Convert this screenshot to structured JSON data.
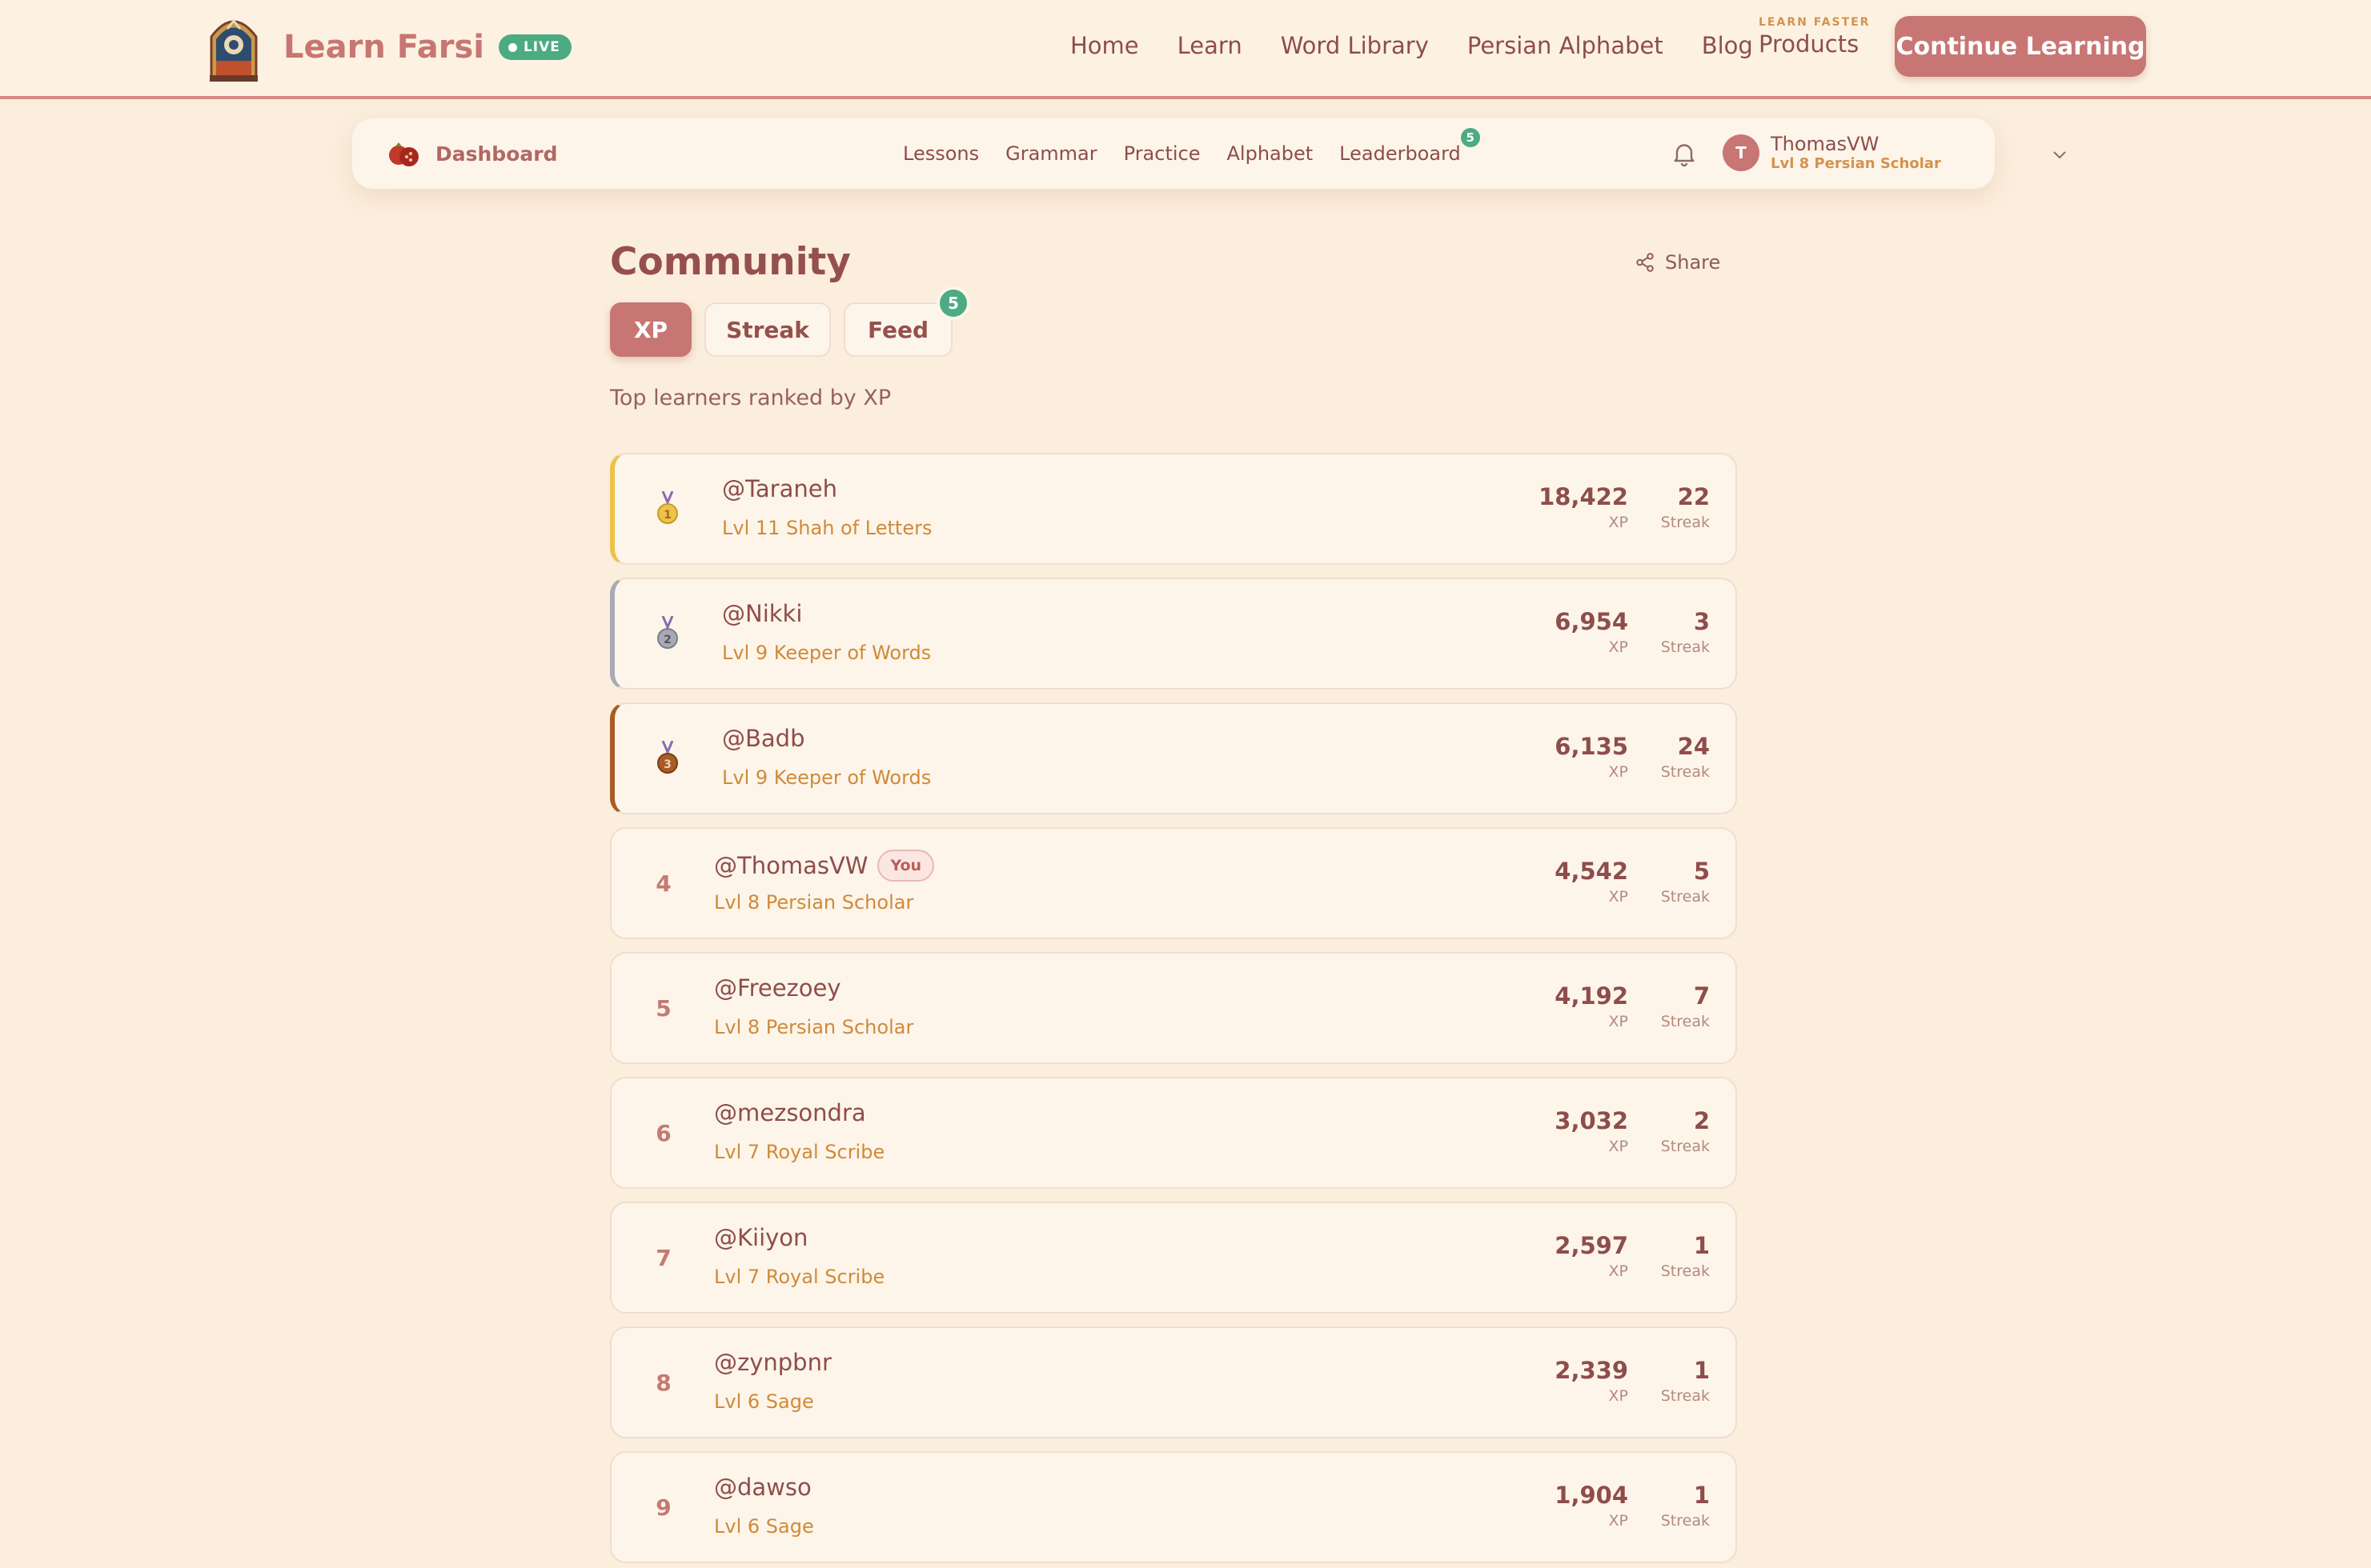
{
  "header": {
    "brand": "Learn Farsi",
    "live_badge": "LIVE",
    "nav": [
      "Home",
      "Learn",
      "Word Library",
      "Persian Alphabet",
      "Blog"
    ],
    "products_tag": "LEARN FASTER",
    "products_label": "Products",
    "cta": "Continue Learning"
  },
  "subnav": {
    "dashboard": "Dashboard",
    "links": [
      "Lessons",
      "Grammar",
      "Practice",
      "Alphabet",
      "Leaderboard"
    ],
    "leaderboard_badge": "5",
    "user": {
      "initial": "T",
      "name": "ThomasVW",
      "level": "Lvl 8 Persian Scholar"
    }
  },
  "community": {
    "title": "Community",
    "share": "Share",
    "tabs": [
      "XP",
      "Streak",
      "Feed"
    ],
    "feed_badge": "5",
    "subtitle": "Top learners ranked by XP",
    "xp_unit": "XP",
    "streak_unit": "Streak",
    "you_label": "You",
    "rows": [
      {
        "rank": "1",
        "name": "@Taraneh",
        "level": "Lvl 11 Shah of Letters",
        "xp": "18,422",
        "streak": "22"
      },
      {
        "rank": "2",
        "name": "@Nikki",
        "level": "Lvl 9 Keeper of Words",
        "xp": "6,954",
        "streak": "3"
      },
      {
        "rank": "3",
        "name": "@Badb",
        "level": "Lvl 9 Keeper of Words",
        "xp": "6,135",
        "streak": "24"
      },
      {
        "rank": "4",
        "name": "@ThomasVW",
        "level": "Lvl 8 Persian Scholar",
        "xp": "4,542",
        "streak": "5"
      },
      {
        "rank": "5",
        "name": "@Freezoey",
        "level": "Lvl 8 Persian Scholar",
        "xp": "4,192",
        "streak": "7"
      },
      {
        "rank": "6",
        "name": "@mezsondra",
        "level": "Lvl 7 Royal Scribe",
        "xp": "3,032",
        "streak": "2"
      },
      {
        "rank": "7",
        "name": "@Kiiyon",
        "level": "Lvl 7 Royal Scribe",
        "xp": "2,597",
        "streak": "1"
      },
      {
        "rank": "8",
        "name": "@zynpbnr",
        "level": "Lvl 6 Sage",
        "xp": "2,339",
        "streak": "1"
      },
      {
        "rank": "9",
        "name": "@dawso",
        "level": "Lvl 6 Sage",
        "xp": "1,904",
        "streak": "1"
      }
    ]
  },
  "colors": {
    "accent": "#c77674",
    "success": "#4cab83",
    "gold": "#eec24b",
    "silver": "#a9a9b6",
    "bronze": "#a85c26"
  }
}
